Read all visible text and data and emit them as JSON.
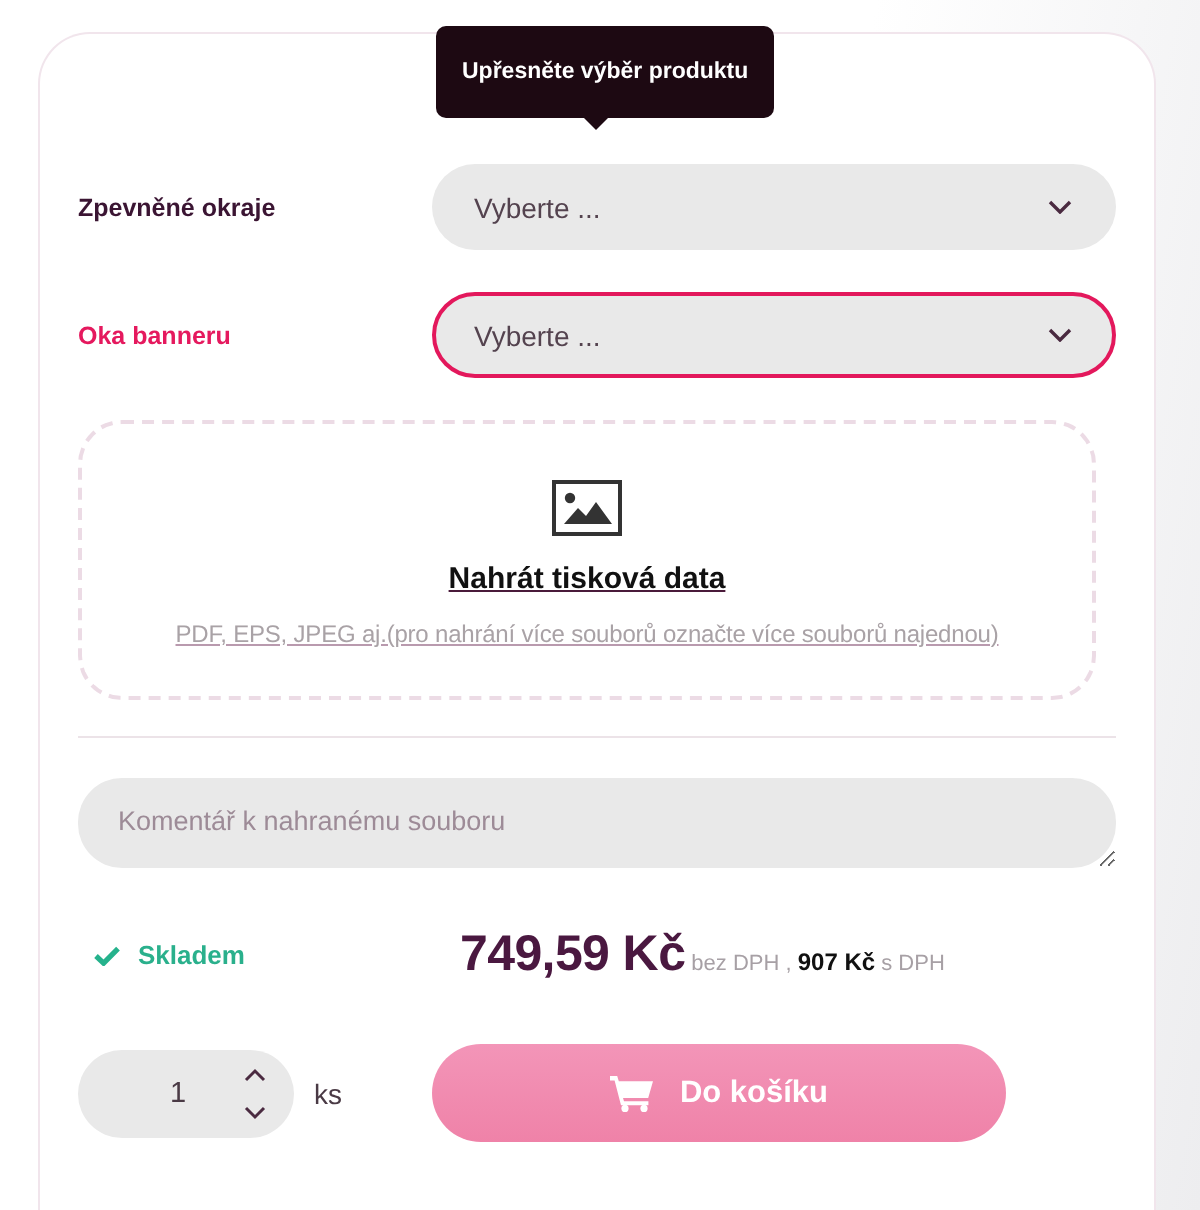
{
  "tooltip": {
    "text": "Upřesněte výběr produktu"
  },
  "options": [
    {
      "label": "Zpevněné okraje",
      "value": "Vyberte ...",
      "invalid": false
    },
    {
      "label": "Oka banneru",
      "value": "Vyberte ...",
      "invalid": true
    }
  ],
  "upload": {
    "title": "Nahrát tisková data",
    "hint": "PDF, EPS, JPEG aj.(pro nahrání více souborů označte více souborů najednou)"
  },
  "comment": {
    "placeholder": "Komentář k nahranému souboru"
  },
  "stock": {
    "label": "Skladem"
  },
  "price": {
    "amount": "749,59 Kč",
    "note": "bez DPH , **907 Kč** s DPH"
  },
  "quantity": {
    "value": "1",
    "unit": "ks"
  },
  "cart_button": {
    "label": "Do košíku"
  }
}
